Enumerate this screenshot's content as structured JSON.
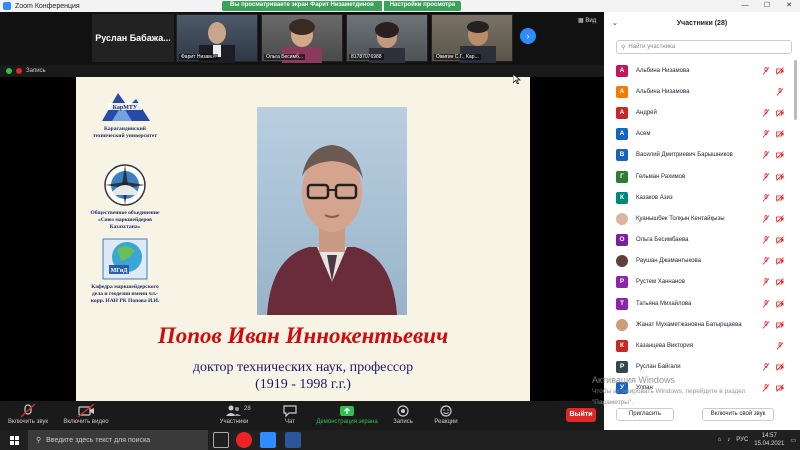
{
  "window": {
    "title": "Zoom Конференция",
    "share_msg": "Вы просматриваете экран Фарит Низаметдинов",
    "share_options": "Настройки просмотра"
  },
  "strip": {
    "name_box": "Руслан  Бабажа...",
    "view_label": "Вид",
    "thumbs": [
      {
        "name": "Фарит Низам..."
      },
      {
        "name": "Ольга Бесимб..."
      },
      {
        "name": "81787076988"
      },
      {
        "name": "Ожигин С.Г., Кар..."
      }
    ]
  },
  "recording": {
    "label": "Запись"
  },
  "slide": {
    "logo1_abbr": "КарМТУ",
    "logo1_text": "Карагандинский технический университет",
    "logo2_text": "Общественное объединение «Союз маркшейдеров Казахстана»",
    "logo3_abbr": "МГиД",
    "logo3_text": "Кафедра маркшейдерского дела и геодезии  имени чл.-корр. НАН РК  Попова И.И.",
    "name": "Попов Иван Иннокентьевич",
    "degree": "доктор технических наук, профессор",
    "years": "(1919 - 1998 г.г.)"
  },
  "toolbar": {
    "mute": "Включить звук",
    "video": "Включить видео",
    "participants": "Участники",
    "participants_count": "28",
    "chat": "Чат",
    "share": "Демонстрация экрана",
    "record": "Запись",
    "reactions": "Реакции",
    "end": "Выйти"
  },
  "panel": {
    "title": "Участники (28)",
    "search_placeholder": "Найти участника",
    "participants": [
      {
        "initial": "А",
        "name": "Альбина Низамова",
        "color": "#c2185b",
        "cam": true
      },
      {
        "initial": "А",
        "name": "Альбина Низамова",
        "color": "#f57c00",
        "cam": false
      },
      {
        "initial": "А",
        "name": "Андрей",
        "color": "#c62828",
        "cam": true
      },
      {
        "initial": "А",
        "name": "Асем",
        "color": "#1565c0",
        "cam": true
      },
      {
        "initial": "В",
        "name": "Василий Дмитриевич Барышников",
        "color": "#1565c0",
        "cam": true
      },
      {
        "initial": "Г",
        "name": "Гельман Рахимов",
        "color": "#2e7d32",
        "cam": true
      },
      {
        "initial": "К",
        "name": "Казаков Азиз",
        "color": "#00897b",
        "cam": true
      },
      {
        "initial": "",
        "name": "Қуанышбек Толқын Кентайқызы",
        "color": "#d7b6a0",
        "cam": true
      },
      {
        "initial": "О",
        "name": "Ольга Бесимбаева",
        "color": "#7b1fa2",
        "cam": true
      },
      {
        "initial": "",
        "name": "Раушан Джамантыкова",
        "color": "#5d4037",
        "cam": true
      },
      {
        "initial": "Р",
        "name": "Рустем Ханнанов",
        "color": "#8e24aa",
        "cam": true
      },
      {
        "initial": "Т",
        "name": "Татьяна Михайлова",
        "color": "#8e24aa",
        "cam": true
      },
      {
        "initial": "",
        "name": "Жанат Мухаметжановна Батырщаева",
        "color": "#caa07a",
        "cam": true
      },
      {
        "initial": "К",
        "name": "Казанцева Виктория",
        "color": "#c62828",
        "cam": false
      },
      {
        "initial": "Р",
        "name": "Руслан Байгали",
        "color": "#37474f",
        "cam": true
      },
      {
        "initial": "У",
        "name": "Улпан",
        "color": "#1565c0",
        "cam": true
      }
    ],
    "invite": "Пригласить",
    "unmute_me": "Включить свой звук"
  },
  "watermark": {
    "line1": "Активация Windows",
    "line2": "Чтобы активировать Windows, перейдите в раздел",
    "line3": "\"Параметры\"."
  },
  "taskbar": {
    "search_placeholder": "Введите здесь текст для поиска",
    "lang": "РУС",
    "time": "14:57",
    "date": "15.04.2021"
  }
}
